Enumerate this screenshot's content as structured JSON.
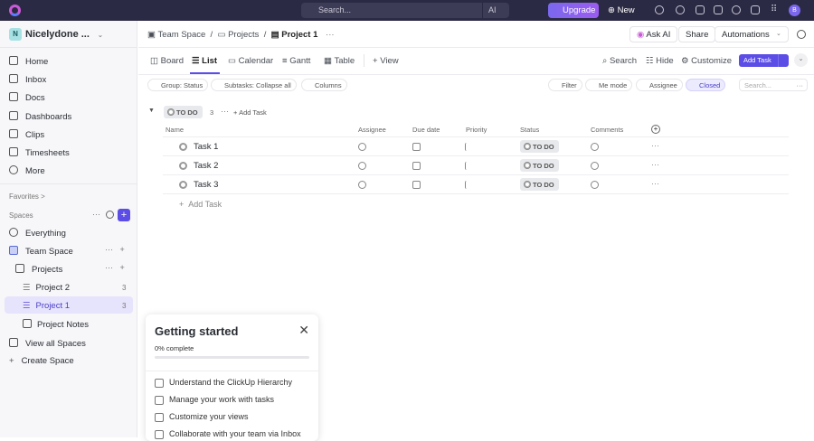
{
  "topbar": {
    "search_placeholder": "Search...",
    "ai_label": "AI",
    "upgrade_label": "Upgrade",
    "new_label": "New",
    "avatar_initial": "B"
  },
  "sidebar": {
    "workspace_initial": "N",
    "workspace_name": "Nicelydone ...",
    "nav": [
      {
        "label": "Home",
        "icon": "home-icon"
      },
      {
        "label": "Inbox",
        "icon": "inbox-icon"
      },
      {
        "label": "Docs",
        "icon": "docs-icon"
      },
      {
        "label": "Dashboards",
        "icon": "dashboard-icon"
      },
      {
        "label": "Clips",
        "icon": "clips-icon"
      },
      {
        "label": "Timesheets",
        "icon": "timesheet-icon"
      },
      {
        "label": "More",
        "icon": "more-icon"
      }
    ],
    "favorites_label": "Favorites >",
    "spaces_label": "Spaces",
    "tree": {
      "everything": "Everything",
      "team_space": "Team Space",
      "projects": "Projects",
      "project2": "Project 2",
      "project2_count": "3",
      "project1": "Project 1",
      "project1_count": "3",
      "notes": "Project Notes",
      "view_all": "View all Spaces",
      "create": "Create Space"
    }
  },
  "header": {
    "breadcrumb": [
      "Team Space",
      "Projects",
      "Project 1"
    ],
    "ask_ai": "Ask AI",
    "share": "Share",
    "automations": "Automations"
  },
  "views": {
    "tabs": [
      "Board",
      "List",
      "Calendar",
      "Gantt",
      "Table"
    ],
    "active": "List",
    "add_view": "View",
    "search": "Search",
    "hide": "Hide",
    "customize": "Customize",
    "add_task": "Add Task"
  },
  "filters": {
    "group": "Group: Status",
    "subtasks": "Subtasks: Collapse all",
    "columns": "Columns",
    "filter": "Filter",
    "me_mode": "Me mode",
    "assignee": "Assignee",
    "closed": "Closed",
    "search_placeholder": "Search..."
  },
  "list": {
    "group_status": "TO DO",
    "group_count": "3",
    "group_add": "Add Task",
    "columns": [
      "Name",
      "Assignee",
      "Due date",
      "Priority",
      "Status",
      "Comments"
    ],
    "tasks": [
      {
        "name": "Task 1",
        "status": "TO DO"
      },
      {
        "name": "Task 2",
        "status": "TO DO"
      },
      {
        "name": "Task 3",
        "status": "TO DO"
      }
    ],
    "add_task": "Add Task"
  },
  "getting_started": {
    "title": "Getting started",
    "progress_label": "0% complete",
    "progress": 0,
    "items": [
      "Understand the ClickUp Hierarchy",
      "Manage your work with tasks",
      "Customize your views",
      "Collaborate with your team via Inbox"
    ]
  },
  "colors": {
    "accent": "#5b4de6",
    "topbar": "#2b2a44",
    "sidebar_active": "#e6e3fc"
  }
}
